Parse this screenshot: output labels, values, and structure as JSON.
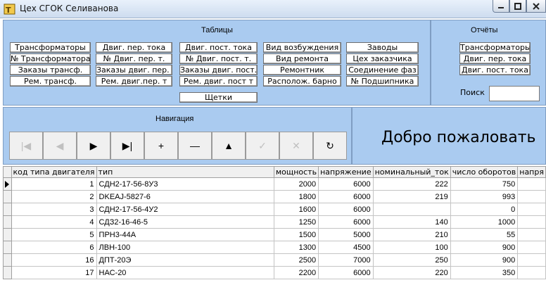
{
  "window": {
    "title": "Цех СГОК Селиванова"
  },
  "tables": {
    "title": "Таблицы",
    "buttons": [
      "Трансформаторы",
      "№ Трансформатора",
      "Заказы трансф.",
      "Рем. трансф.",
      "Двиг. пер. тока",
      "№ Двиг. пер. т.",
      "Заказы двиг. пер. т.",
      "Рем. двиг.пер. т",
      "Двиг. пост. тока",
      "№ Двиг. пост. т.",
      "Заказы двиг. пост. т.",
      "Рем. двиг. пост т",
      "Вид возбуждения",
      "Вид ремонта",
      "Ремонтник",
      "Располож. барно",
      "Заводы",
      "Цех заказчика",
      "Соединение фаз",
      "№ Подшипника",
      "Щетки"
    ]
  },
  "reports": {
    "title": "Отчёты",
    "buttons": [
      "Трансформаторы",
      "Двиг. пер. тока",
      "Двиг. пост. тока"
    ],
    "search_label": "Поиск"
  },
  "navigation": {
    "title": "Навигация",
    "buttons": [
      {
        "icon": "first-record-icon",
        "glyph": "|◀",
        "enabled": false
      },
      {
        "icon": "prior-record-icon",
        "glyph": "◀",
        "enabled": false
      },
      {
        "icon": "next-record-icon",
        "glyph": "▶",
        "enabled": true
      },
      {
        "icon": "last-record-icon",
        "glyph": "▶|",
        "enabled": true
      },
      {
        "icon": "insert-record-icon",
        "glyph": "+",
        "enabled": true
      },
      {
        "icon": "delete-record-icon",
        "glyph": "—",
        "enabled": true
      },
      {
        "icon": "edit-record-icon",
        "glyph": "▲",
        "enabled": true
      },
      {
        "icon": "post-record-icon",
        "glyph": "✓",
        "enabled": false
      },
      {
        "icon": "cancel-record-icon",
        "glyph": "✕",
        "enabled": false
      },
      {
        "icon": "refresh-icon",
        "glyph": "↻",
        "enabled": true
      }
    ]
  },
  "welcome": {
    "text": "Добро пожаловать"
  },
  "grid": {
    "columns": [
      "код типа двигателя",
      "тип",
      "мощность",
      "напряжение",
      "номинальный_ток",
      "число оборотов",
      "напря"
    ],
    "rows": [
      [
        "1",
        "СДН2-17-56-8У3",
        "2000",
        "6000",
        "222",
        "750",
        ""
      ],
      [
        "2",
        "DKEAJ-5827-6",
        "1800",
        "6000",
        "219",
        "993",
        ""
      ],
      [
        "3",
        "СДН2-17-56-4У2",
        "1600",
        "6000",
        "",
        "0",
        ""
      ],
      [
        "4",
        "СДЗ2-16-46-5",
        "1250",
        "6000",
        "140",
        "1000",
        ""
      ],
      [
        "5",
        "ПРН3-44А",
        "1500",
        "5000",
        "210",
        "55",
        ""
      ],
      [
        "6",
        "ЛВН-100",
        "1300",
        "4500",
        "100",
        "900",
        ""
      ],
      [
        "16",
        "ДПТ-20Э",
        "2500",
        "7000",
        "250",
        "900",
        ""
      ],
      [
        "17",
        "НАС-20",
        "2200",
        "6000",
        "220",
        "350",
        ""
      ]
    ]
  }
}
